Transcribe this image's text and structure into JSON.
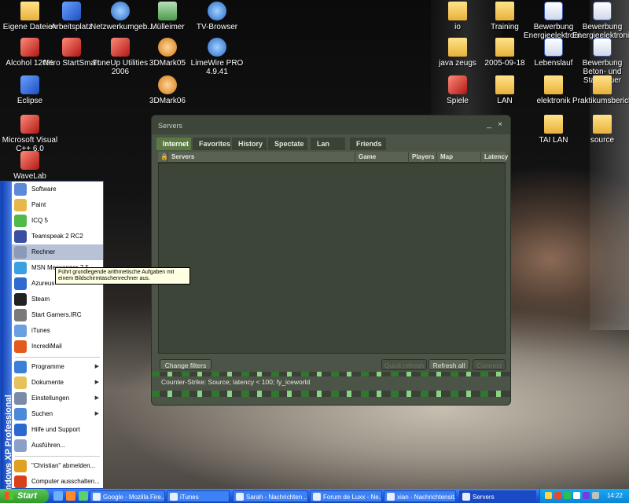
{
  "desktop": {
    "icons": [
      {
        "label": "Eigene Dateien",
        "kind": "folder"
      },
      {
        "label": "Arbeitsplatz",
        "kind": "app"
      },
      {
        "label": "Netzwerkumgeb...",
        "kind": "net"
      },
      {
        "label": "Mülleimer",
        "kind": "trash"
      },
      {
        "label": "TV-Browser",
        "kind": "net"
      },
      {
        "label": "io",
        "kind": "folder"
      },
      {
        "label": "Training",
        "kind": "folder"
      },
      {
        "label": "Bewerbung Energieelektroni...",
        "kind": "doc"
      },
      {
        "label": "Bewerbung Energieelektroniker",
        "kind": "doc"
      },
      {
        "label": "Alcohol 120%",
        "kind": "red"
      },
      {
        "label": "Nero StartSmart",
        "kind": "red"
      },
      {
        "label": "TuneUp Utilities 2006",
        "kind": "red"
      },
      {
        "label": "3DMark05",
        "kind": "chat"
      },
      {
        "label": "LimeWire PRO 4.9.41",
        "kind": "net"
      },
      {
        "label": "java zeugs",
        "kind": "folder"
      },
      {
        "label": "2005-09-18",
        "kind": "folder"
      },
      {
        "label": "Lebenslauf",
        "kind": "doc"
      },
      {
        "label": "Bewerbung Beton- und Stahlbauer",
        "kind": "doc"
      },
      {
        "label": "Eclipse",
        "kind": "app"
      },
      {
        "label": "3DMark06",
        "kind": "chat"
      },
      {
        "label": "Spiele",
        "kind": "red"
      },
      {
        "label": "LAN",
        "kind": "folder"
      },
      {
        "label": "elektronik",
        "kind": "folder"
      },
      {
        "label": "Praktikumsbericht",
        "kind": "folder"
      },
      {
        "label": "Microsoft Visual C++ 6.0",
        "kind": "red"
      },
      {
        "label": "TAI LAN",
        "kind": "folder"
      },
      {
        "label": "source",
        "kind": "folder"
      },
      {
        "label": "WaveLab",
        "kind": "red"
      }
    ]
  },
  "servers_window": {
    "title": "Servers",
    "min_glyph": "_",
    "close_glyph": "×",
    "tabs": [
      "Internet",
      "Favorites",
      "History",
      "Spectate",
      "Lan",
      "Friends"
    ],
    "active_tab": "Internet",
    "columns": [
      "Servers",
      "Game",
      "Players",
      "Map",
      "Latency"
    ],
    "buttons": {
      "change_filters": "Change filters",
      "quick_refresh": "Quick refresh",
      "refresh_all": "Refresh all",
      "connect": "Connect"
    },
    "filter_status": "Counter-Strike: Source; latency < 100; fy_iceworld"
  },
  "start_menu": {
    "band_text": "Windows XP Professional",
    "pinned": [
      {
        "label": "Software",
        "color": "#5a8ad8"
      },
      {
        "label": "Paint",
        "color": "#e6b84a"
      },
      {
        "label": "ICQ 5",
        "color": "#4fb94a"
      },
      {
        "label": "Teamspeak 2 RC2",
        "color": "#3b4fa0"
      },
      {
        "label": "Rechner",
        "color": "#8a9ab8"
      },
      {
        "label": "MSN Messenger 7.5",
        "color": "#3aa0e0"
      },
      {
        "label": "Azureus",
        "color": "#2f6ad0"
      },
      {
        "label": "Steam",
        "color": "#222222"
      },
      {
        "label": "Start Gamers.IRC",
        "color": "#7a7a7a"
      },
      {
        "label": "iTunes",
        "color": "#6aa0e0"
      },
      {
        "label": "IncrediMail",
        "color": "#e25a1c"
      }
    ],
    "highlighted": "Rechner",
    "system": [
      {
        "label": "Programme",
        "has_submenu": true,
        "color": "#3a7fd8"
      },
      {
        "label": "Dokumente",
        "has_submenu": true,
        "color": "#e6c35a"
      },
      {
        "label": "Einstellungen",
        "has_submenu": true,
        "color": "#7a8aa8"
      },
      {
        "label": "Suchen",
        "has_submenu": true,
        "color": "#4a8ad8"
      },
      {
        "label": "Hilfe und Support",
        "has_submenu": false,
        "color": "#2a6ad0"
      },
      {
        "label": "Ausführen...",
        "has_submenu": false,
        "color": "#8aa0c8"
      }
    ],
    "logoff": "\"Christian\" abmelden...",
    "shutdown": "Computer ausschalten..."
  },
  "tooltip": {
    "text": "Führt grundlegende arithmetische Aufgaben mit einem Bildschirmtaschenrechner aus."
  },
  "taskbar": {
    "start_label": "Start",
    "tasks": [
      {
        "label": "Google - Mozilla Fire...",
        "active": false
      },
      {
        "label": "iTunes",
        "active": false
      },
      {
        "label": "Sarah - Nachrichten ...",
        "active": false
      },
      {
        "label": "Forum de Luxx - Ne...",
        "active": false
      },
      {
        "label": "xian - Nachrichtensit...",
        "active": false
      },
      {
        "label": "Servers",
        "active": true
      }
    ],
    "clock": "14:22"
  }
}
